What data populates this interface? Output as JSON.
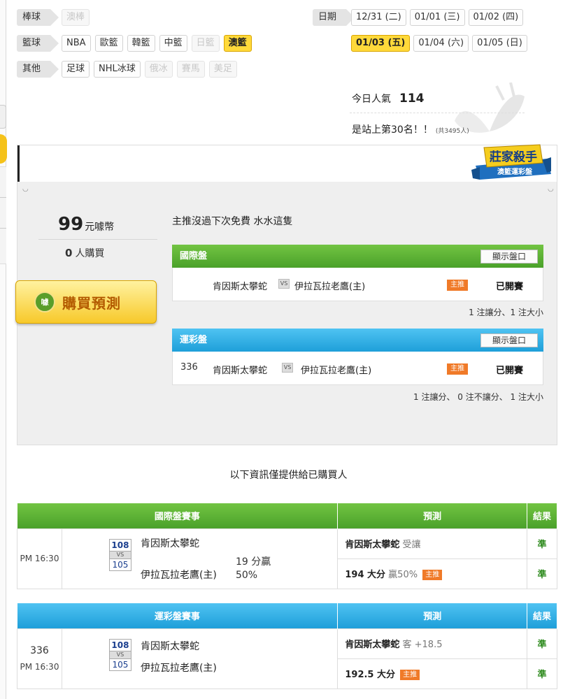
{
  "filters": {
    "baseball": {
      "category": "棒球",
      "items": [
        {
          "label": "澳棒",
          "state": "disabled"
        }
      ]
    },
    "basketball": {
      "category": "籃球",
      "items": [
        {
          "label": "NBA",
          "state": "normal"
        },
        {
          "label": "歐籃",
          "state": "normal"
        },
        {
          "label": "韓籃",
          "state": "normal"
        },
        {
          "label": "中籃",
          "state": "normal"
        },
        {
          "label": "日籃",
          "state": "disabled"
        },
        {
          "label": "澳籃",
          "state": "active"
        }
      ]
    },
    "other": {
      "category": "其他",
      "items": [
        {
          "label": "足球",
          "state": "normal"
        },
        {
          "label": "NHL冰球",
          "state": "normal"
        },
        {
          "label": "俄冰",
          "state": "disabled"
        },
        {
          "label": "賽馬",
          "state": "disabled"
        },
        {
          "label": "美足",
          "state": "disabled"
        }
      ]
    }
  },
  "dates": {
    "label": "日期",
    "row1": [
      {
        "label": "12/31 (二)",
        "active": false
      },
      {
        "label": "01/01 (三)",
        "active": false
      },
      {
        "label": "01/02 (四)",
        "active": false
      }
    ],
    "row2": [
      {
        "label": "01/03 (五)",
        "active": true
      },
      {
        "label": "01/04 (六)",
        "active": false
      },
      {
        "label": "01/05 (日)",
        "active": false
      }
    ]
  },
  "stats": {
    "popularity_label": "今日人氣",
    "popularity_value": "114",
    "rank_text": "是站上第30名！！",
    "rank_total": "(共3495人)"
  },
  "badge": {
    "title": "莊家殺手",
    "subtitle": "澳籃運彩盤"
  },
  "purchase": {
    "price": "99",
    "price_unit": "元噱幣",
    "buyers_count": "0",
    "buyers_label": "人購買",
    "buy_button": "購買預測",
    "buy_icon_text": "噱"
  },
  "description": "主推沒過下次免費 水水這隻",
  "intl_panel": {
    "title": "國際盤",
    "show_button": "顯示盤口",
    "number": "",
    "away": "肯因斯太攀蛇",
    "vs": "VS",
    "home": "伊拉瓦拉老鷹(主)",
    "star": "主推",
    "status": "已開賽",
    "note": "1 注讓分、1 注大小"
  },
  "lottery_panel": {
    "title": "運彩盤",
    "show_button": "顯示盤口",
    "number": "336",
    "away": "肯因斯太攀蛇",
    "vs": "VS",
    "home": "伊拉瓦拉老鷹(主)",
    "star": "主推",
    "status": "已開賽",
    "note": "1 注讓分、 0 注不讓分、 1 注大小"
  },
  "info_line": "以下資訊僅提供給已購買人",
  "intl_table": {
    "headers": {
      "event": "國際盤賽事",
      "prediction": "預測",
      "result": "結果"
    },
    "time": "PM 16:30",
    "away": "肯因斯太攀蛇",
    "home": "伊拉瓦拉老鷹(主)",
    "away_score": "108",
    "home_score": "105",
    "vs": "VS",
    "spread_line1": "19 分贏",
    "spread_line2": "50%",
    "pred1_team": "肯因斯太攀蛇",
    "pred1_extra": "受讓",
    "pred2_main": "194 大分",
    "pred2_extra": "贏50%",
    "pred2_star": "主推",
    "result1": "準",
    "result2": "準"
  },
  "lottery_table": {
    "headers": {
      "event": "運彩盤賽事",
      "prediction": "預測",
      "result": "結果"
    },
    "number": "336",
    "time": "PM 16:30",
    "away": "肯因斯太攀蛇",
    "home": "伊拉瓦拉老鷹(主)",
    "away_score": "108",
    "home_score": "105",
    "vs": "VS",
    "pred1_team": "肯因斯太攀蛇",
    "pred1_extra": "客 +18.5",
    "pred2_main": "192.5 大分",
    "pred2_star": "主推",
    "result1": "準",
    "result2": "準"
  },
  "colors": {
    "green_header": "#4aa12a",
    "blue_header": "#1e9fd9",
    "active_chip": "#ffd93a",
    "star_tag": "#f07a28",
    "result_text": "#2e8b1e"
  }
}
